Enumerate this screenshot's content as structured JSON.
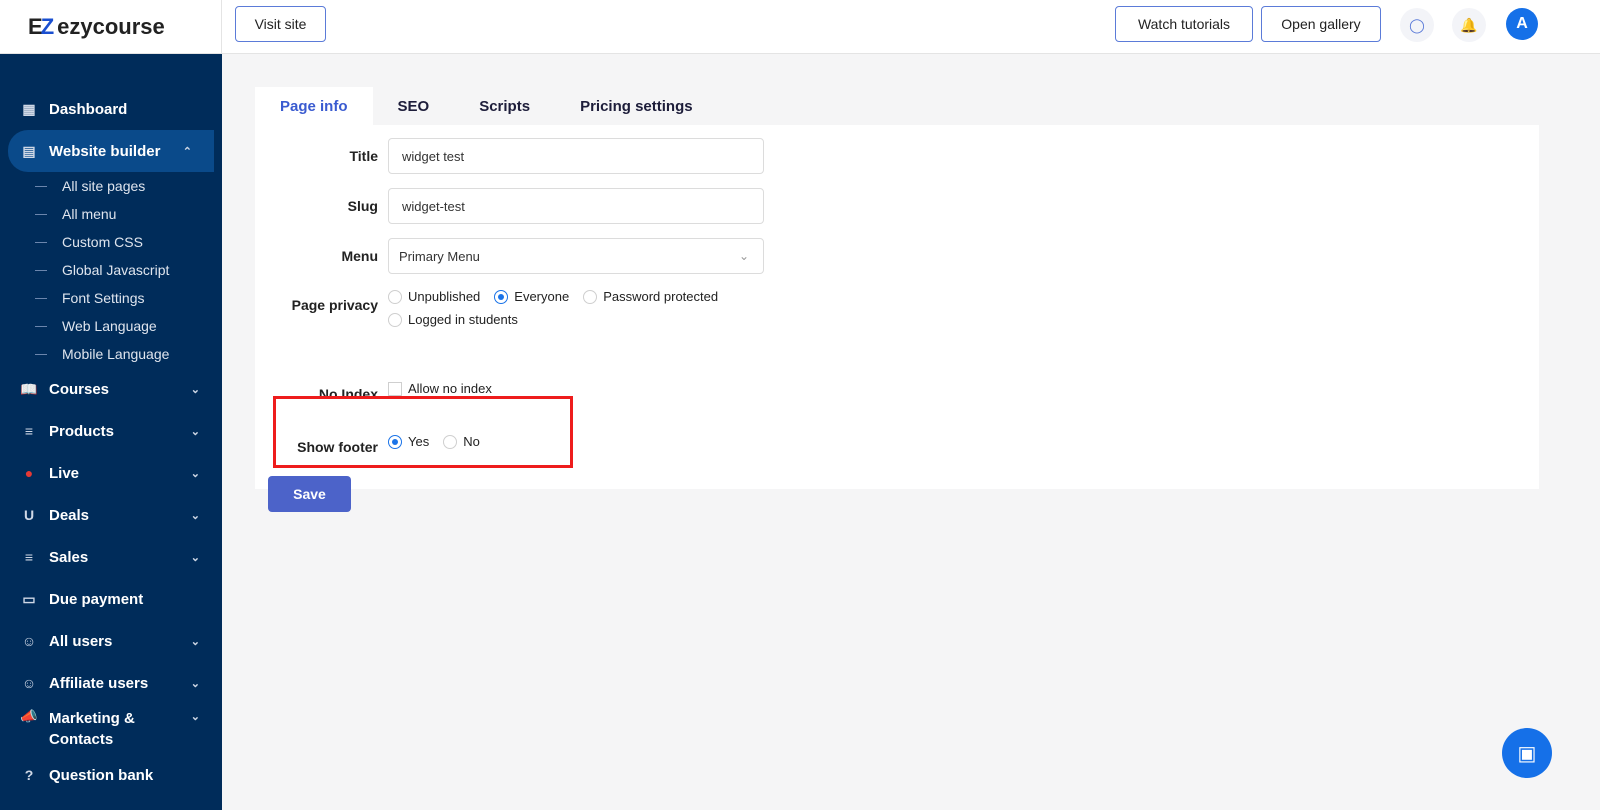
{
  "header": {
    "logo": "ezycourse",
    "logo_mark": "EZ",
    "visit_site": "Visit site",
    "watch_tutorials": "Watch tutorials",
    "open_gallery": "Open gallery",
    "avatar": "A"
  },
  "sidebar": {
    "dashboard": "Dashboard",
    "website_builder": "Website builder",
    "sub": [
      "All site pages",
      "All menu",
      "Custom CSS",
      "Global Javascript",
      "Font Settings",
      "Web Language",
      "Mobile Language"
    ],
    "items": [
      "Courses",
      "Products",
      "Live",
      "Deals",
      "Sales",
      "Due payment",
      "All users",
      "Affiliate users",
      "Marketing & Contacts",
      "Question bank"
    ]
  },
  "tabs": [
    "Page info",
    "SEO",
    "Scripts",
    "Pricing settings"
  ],
  "form": {
    "title_label": "Title",
    "title_value": "widget test",
    "slug_label": "Slug",
    "slug_value": "widget-test",
    "menu_label": "Menu",
    "menu_value": "Primary Menu",
    "privacy_label": "Page privacy",
    "privacy_options": [
      "Unpublished",
      "Everyone",
      "Password protected",
      "Logged in students"
    ],
    "privacy_selected": "Everyone",
    "noindex_label": "No Index",
    "noindex_option": "Allow no index",
    "footer_label": "Show footer",
    "footer_options": [
      "Yes",
      "No"
    ],
    "footer_selected": "Yes",
    "save": "Save"
  },
  "colors": {
    "sidebar": "#002c5a",
    "accent": "#4c63c9",
    "highlight": "#ee1c1c"
  }
}
